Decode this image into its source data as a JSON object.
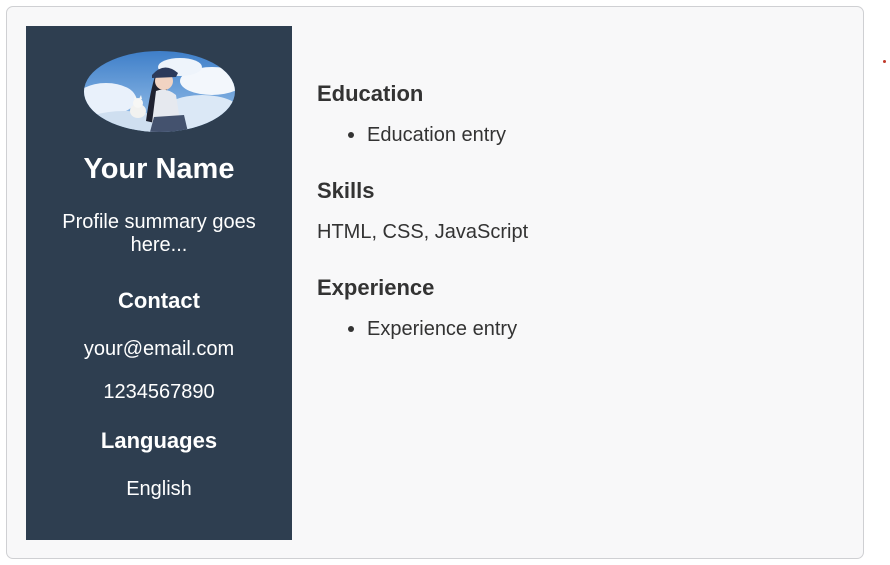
{
  "sidebar": {
    "avatar_icon": "profile-photo-anime-girl-with-cat",
    "name": "Your Name",
    "summary": "Profile summary goes here...",
    "contact_heading": "Contact",
    "email": "your@email.com",
    "phone": "1234567890",
    "languages_heading": "Languages",
    "language": "English"
  },
  "main": {
    "education_heading": "Education",
    "education_items": [
      "Education entry"
    ],
    "skills_heading": "Skills",
    "skills_text": "HTML, CSS, JavaScript",
    "experience_heading": "Experience",
    "experience_items": [
      "Experience entry"
    ]
  },
  "colors": {
    "sidebar_bg": "#2e3e50",
    "card_bg": "#f8f8f9",
    "text": "#333333",
    "stray_dot": "#c0392b"
  }
}
